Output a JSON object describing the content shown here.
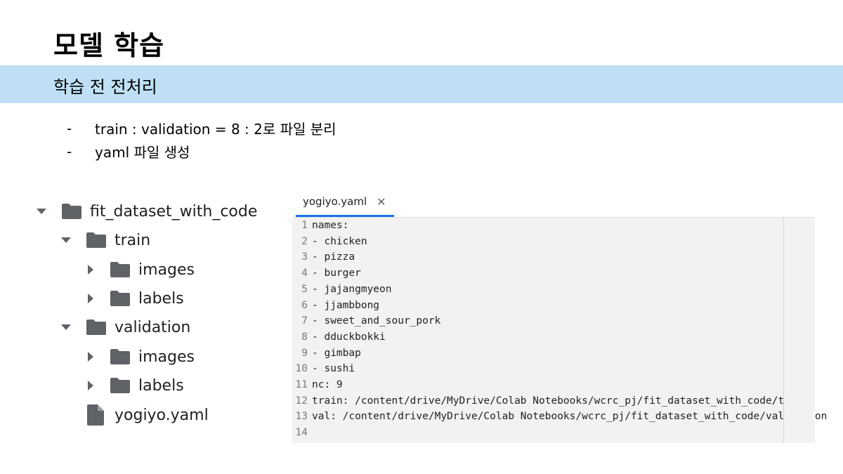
{
  "slide": {
    "title": "모델 학습",
    "section": "학습 전 전처리",
    "bullets": [
      {
        "dash": "-",
        "text": "train : validation  = 8 : 2로 파일 분리"
      },
      {
        "dash": "-",
        "text": "yaml 파일 생성"
      }
    ]
  },
  "tree": {
    "items": [
      {
        "label": "fit_dataset_with_code",
        "type": "folder",
        "state": "expanded"
      },
      {
        "label": "train",
        "type": "folder",
        "state": "expanded"
      },
      {
        "label": "images",
        "type": "folder",
        "state": "collapsed"
      },
      {
        "label": "labels",
        "type": "folder",
        "state": "collapsed"
      },
      {
        "label": "validation",
        "type": "folder",
        "state": "expanded"
      },
      {
        "label": "images",
        "type": "folder",
        "state": "collapsed"
      },
      {
        "label": "labels",
        "type": "folder",
        "state": "collapsed"
      },
      {
        "label": "yogiyo.yaml",
        "type": "file",
        "state": "none"
      }
    ]
  },
  "editor": {
    "tab_label": "yogiyo.yaml",
    "close_glyph": "✕",
    "lines": [
      {
        "n": "1",
        "text": "names:"
      },
      {
        "n": "2",
        "text": "- chicken"
      },
      {
        "n": "3",
        "text": "- pizza"
      },
      {
        "n": "4",
        "text": "- burger"
      },
      {
        "n": "5",
        "text": "- jajangmyeon"
      },
      {
        "n": "6",
        "text": "- jjambbong"
      },
      {
        "n": "7",
        "text": "- sweet_and_sour_pork"
      },
      {
        "n": "8",
        "text": "- dduckbokki"
      },
      {
        "n": "9",
        "text": "- gimbap"
      },
      {
        "n": "10",
        "text": "- sushi"
      },
      {
        "n": "11",
        "text": "nc: 9"
      },
      {
        "n": "12",
        "text": "train: /content/drive/MyDrive/Colab Notebooks/wcrc_pj/fit_dataset_with_code/train"
      },
      {
        "n": "13",
        "text": "val: /content/drive/MyDrive/Colab Notebooks/wcrc_pj/fit_dataset_with_code/validation"
      },
      {
        "n": "14",
        "text": ""
      }
    ]
  },
  "colors": {
    "band": "#bfe0f4",
    "tab_underline": "#1a73e8",
    "folder_icon": "#5f6368",
    "editor_bg": "#f2f2f2"
  }
}
